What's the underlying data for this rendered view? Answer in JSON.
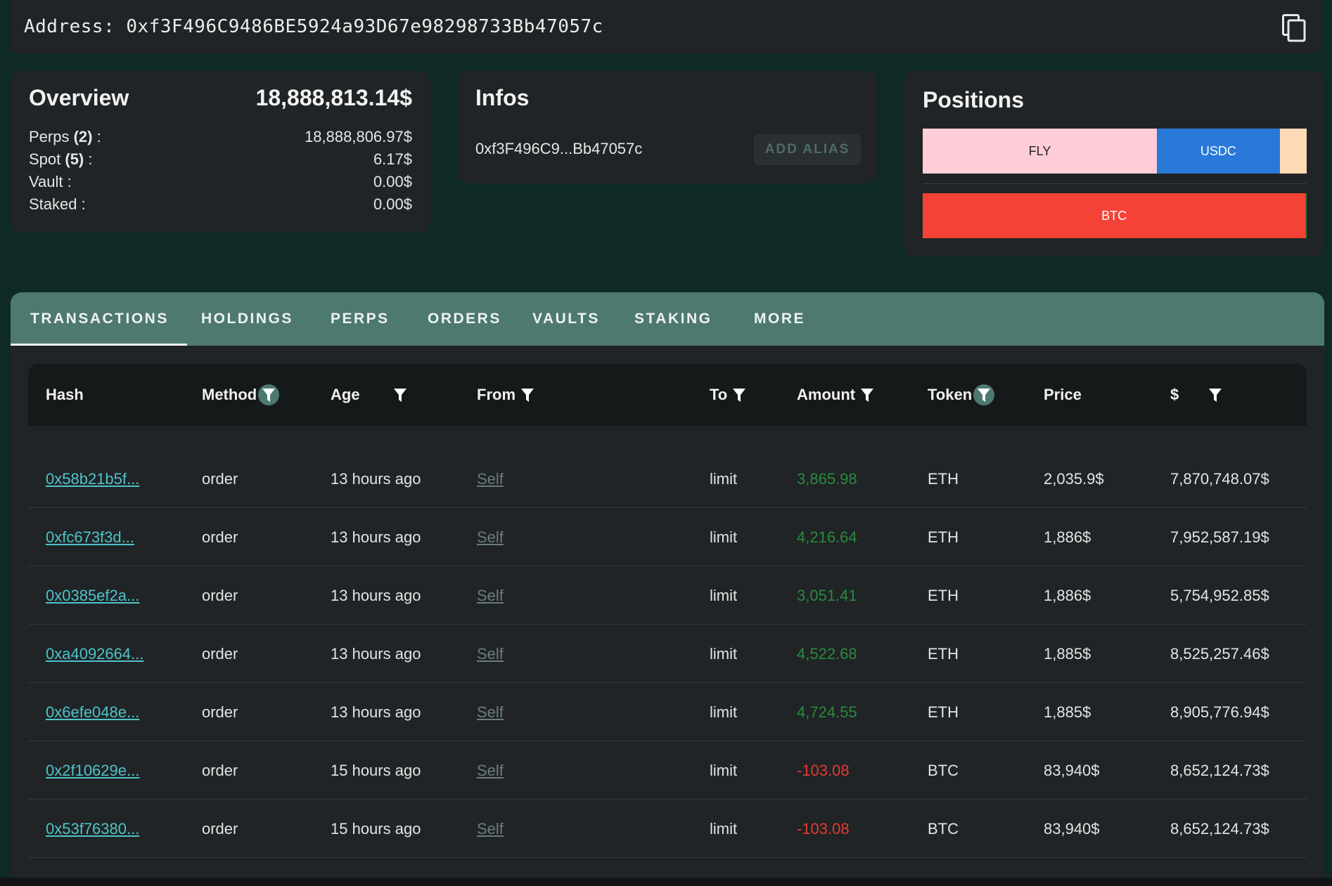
{
  "address_bar": {
    "label": "Address:",
    "address": "0xf3F496C9486BE5924a93D67e98298733Bb47057c",
    "copy_icon": "copy-icon"
  },
  "overview": {
    "title": "Overview",
    "total": "18,888,813.14$",
    "rows": [
      {
        "label": "Perps",
        "count": "(2)",
        "suffix": " :",
        "value": "18,888,806.97$"
      },
      {
        "label": "Spot",
        "count": "(5)",
        "suffix": " :",
        "value": "6.17$"
      },
      {
        "label": "Vault :",
        "count": "",
        "suffix": "",
        "value": "0.00$"
      },
      {
        "label": "Staked :",
        "count": "",
        "suffix": "",
        "value": "0.00$"
      }
    ]
  },
  "infos": {
    "title": "Infos",
    "short_address": "0xf3F496C9...Bb47057c",
    "add_alias_label": "ADD ALIAS"
  },
  "positions": {
    "title": "Positions",
    "bars": [
      {
        "segments": [
          {
            "label": "FLY",
            "share": 0.61,
            "color": "#fecdd8",
            "text_color": "#222222"
          },
          {
            "label": "USDC",
            "share": 0.32,
            "color": "#2979d8",
            "text_color": "#ffffff"
          },
          {
            "label": "",
            "share": 0.07,
            "color": "#fdd9b5",
            "text_color": "#222222"
          }
        ]
      },
      {
        "segments": [
          {
            "label": "BTC",
            "share": 0.997,
            "color": "#f44336",
            "text_color": "#ffffff"
          },
          {
            "label": "",
            "share": 0.003,
            "color": "#2e7d32",
            "text_color": "#ffffff"
          }
        ]
      }
    ]
  },
  "tabs": [
    "TRANSACTIONS",
    "HOLDINGS",
    "PERPS",
    "ORDERS",
    "VAULTS",
    "STAKING",
    "MORE"
  ],
  "active_tab": "TRANSACTIONS",
  "table": {
    "columns": [
      "Hash",
      "Method",
      "Age",
      "From",
      "To",
      "Amount",
      "Token",
      "Price",
      "$"
    ],
    "rows": [
      {
        "hash": "0x58b21b5f...",
        "method": "order",
        "age": "13 hours ago",
        "from": "Self",
        "to": "limit",
        "amount": "3,865.98",
        "sign": "pos",
        "token": "ETH",
        "price": "2,035.9$",
        "usd": "7,870,748.07$"
      },
      {
        "hash": "0xfc673f3d...",
        "method": "order",
        "age": "13 hours ago",
        "from": "Self",
        "to": "limit",
        "amount": "4,216.64",
        "sign": "pos",
        "token": "ETH",
        "price": "1,886$",
        "usd": "7,952,587.19$"
      },
      {
        "hash": "0x0385ef2a...",
        "method": "order",
        "age": "13 hours ago",
        "from": "Self",
        "to": "limit",
        "amount": "3,051.41",
        "sign": "pos",
        "token": "ETH",
        "price": "1,886$",
        "usd": "5,754,952.85$"
      },
      {
        "hash": "0xa4092664...",
        "method": "order",
        "age": "13 hours ago",
        "from": "Self",
        "to": "limit",
        "amount": "4,522.68",
        "sign": "pos",
        "token": "ETH",
        "price": "1,885$",
        "usd": "8,525,257.46$"
      },
      {
        "hash": "0x6efe048e...",
        "method": "order",
        "age": "13 hours ago",
        "from": "Self",
        "to": "limit",
        "amount": "4,724.55",
        "sign": "pos",
        "token": "ETH",
        "price": "1,885$",
        "usd": "8,905,776.94$"
      },
      {
        "hash": "0x2f10629e...",
        "method": "order",
        "age": "15 hours ago",
        "from": "Self",
        "to": "limit",
        "amount": "-103.08",
        "sign": "neg",
        "token": "BTC",
        "price": "83,940$",
        "usd": "8,652,124.73$"
      },
      {
        "hash": "0x53f76380...",
        "method": "order",
        "age": "15 hours ago",
        "from": "Self",
        "to": "limit",
        "amount": "-103.08",
        "sign": "neg",
        "token": "BTC",
        "price": "83,940$",
        "usd": "8,652,124.73$"
      }
    ]
  },
  "colors": {
    "background": "#0f2a25",
    "card": "#202426",
    "tab_bar": "#4e7970",
    "link": "#4fc3c9",
    "positive": "#2b8a3e",
    "negative": "#e53935"
  }
}
